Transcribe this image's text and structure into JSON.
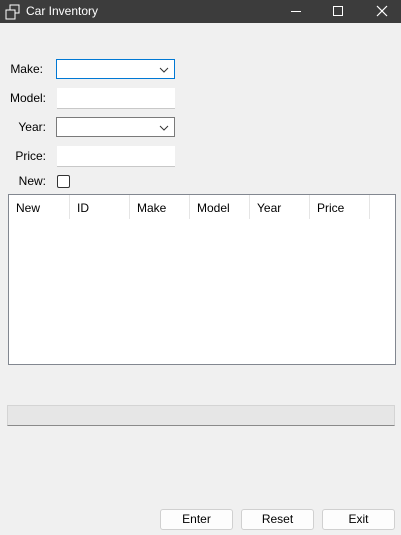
{
  "window": {
    "title": "Car Inventory"
  },
  "form": {
    "make_label": "Make:",
    "model_label": "Model:",
    "year_label": "Year:",
    "price_label": "Price:",
    "new_label": "New:",
    "make_value": "",
    "model_value": "",
    "year_value": "",
    "price_value": "",
    "new_checked": false
  },
  "grid": {
    "columns": [
      "New",
      "ID",
      "Make",
      "Model",
      "Year",
      "Price"
    ],
    "rows": []
  },
  "progress": {
    "value": 0
  },
  "buttons": {
    "enter": "Enter",
    "reset": "Reset",
    "exit": "Exit"
  },
  "icons": {
    "app": "window-stack-icon",
    "minimize": "minimize-icon",
    "maximize": "maximize-icon",
    "close": "close-icon",
    "combo_arrow": "chevron-down-icon"
  },
  "colors": {
    "titlebar": "#3c3c3c",
    "focus_border": "#0078d4",
    "background": "#f0f0f0"
  }
}
